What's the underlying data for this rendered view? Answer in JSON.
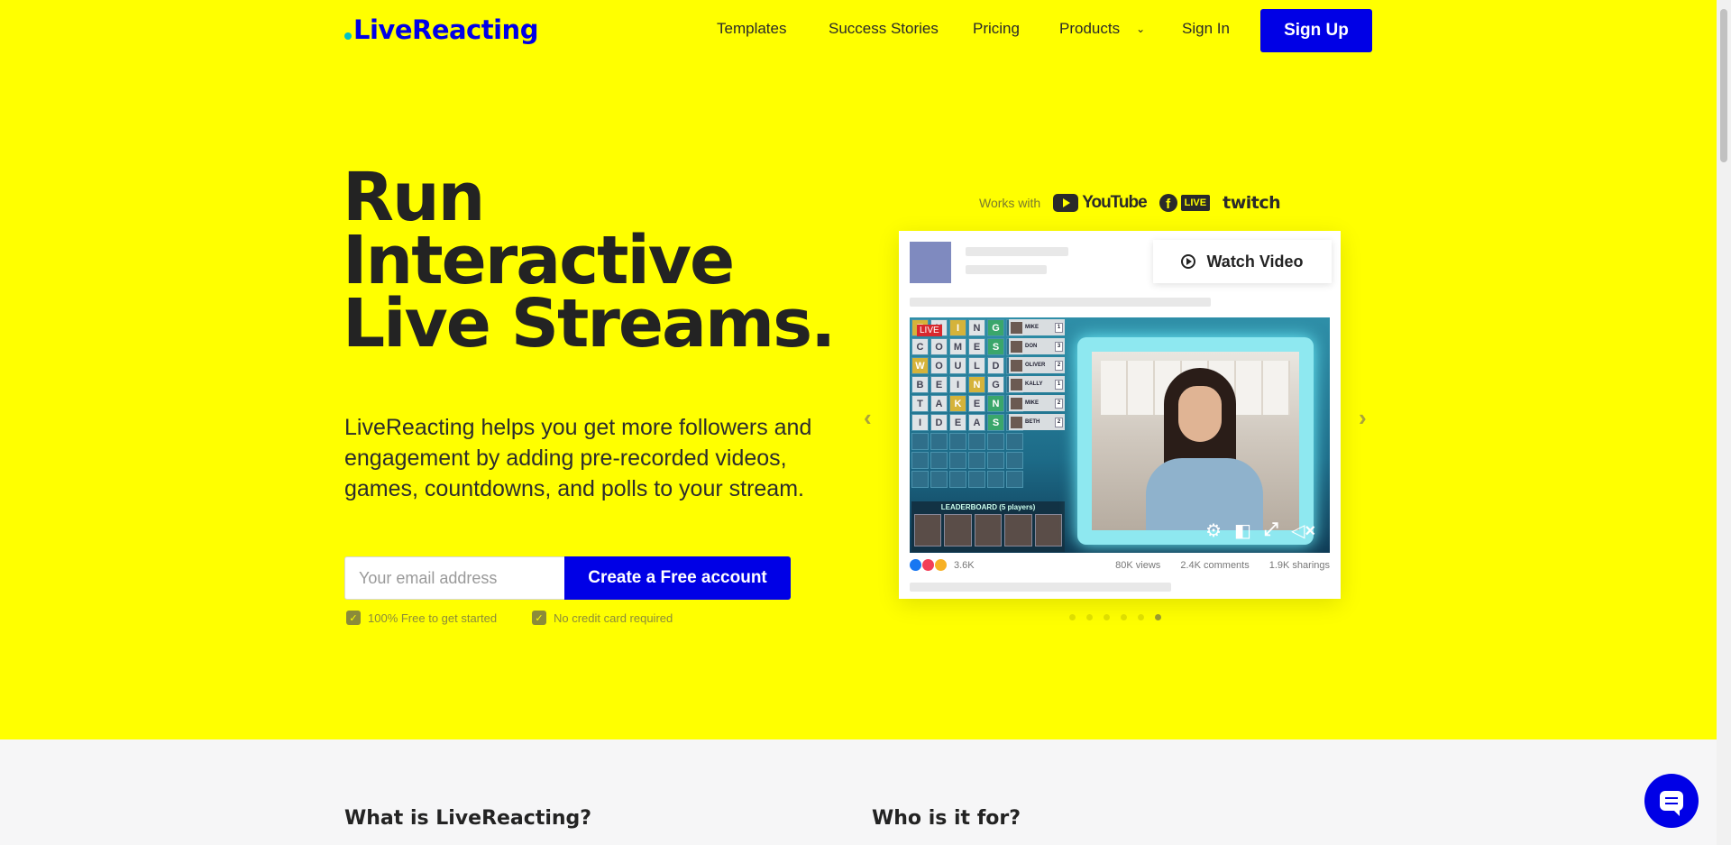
{
  "header": {
    "logo": "LiveReacting",
    "nav": [
      "Templates",
      "Success Stories",
      "Pricing",
      "Products"
    ],
    "sign_in": "Sign In",
    "sign_up": "Sign Up"
  },
  "hero": {
    "headline": [
      "Run",
      "Interactive",
      "Live Streams."
    ],
    "subtext": "LiveReacting helps you get more followers and engagement by adding pre-recorded videos, games, countdowns, and polls to your stream.",
    "email_placeholder": "Your email address",
    "cta": "Create a Free account",
    "checks": [
      "100% Free to get started",
      "No credit card required"
    ]
  },
  "works_with": {
    "label": "Works with",
    "platforms": [
      "YouTube",
      "LIVE",
      "twitch"
    ]
  },
  "preview": {
    "watch_video": "Watch Video",
    "live_tag": "LIVE",
    "word_rows": [
      "THING",
      "COMES",
      "WOULD",
      "BEING",
      "TAKEN",
      "IDEAS"
    ],
    "players": [
      {
        "name": "MIKE",
        "score": "1"
      },
      {
        "name": "DON",
        "score": "3"
      },
      {
        "name": "OLIVER",
        "score": "2"
      },
      {
        "name": "KALLY",
        "score": "1"
      },
      {
        "name": "MIKE",
        "score": "2"
      },
      {
        "name": "BETH",
        "score": "2"
      }
    ],
    "leaderboard_title": "LEADERBOARD (5 players)",
    "reactions": "3.6K",
    "views": "80K views",
    "comments": "2.4K comments",
    "sharings": "1.9K sharings",
    "carousel_active_index": 5
  },
  "sections": {
    "what": "What is LiveReacting?",
    "who": "Who is it for?"
  },
  "colors": {
    "hero_bg": "#ffff00",
    "brand_blue": "#0000e6"
  },
  "icons": [
    "chevron-down-icon",
    "play-circle-icon",
    "settings-icon",
    "picture-in-picture-icon",
    "fullscreen-icon",
    "mute-icon",
    "chevron-left-icon",
    "chevron-right-icon",
    "check-icon",
    "chat-icon"
  ]
}
